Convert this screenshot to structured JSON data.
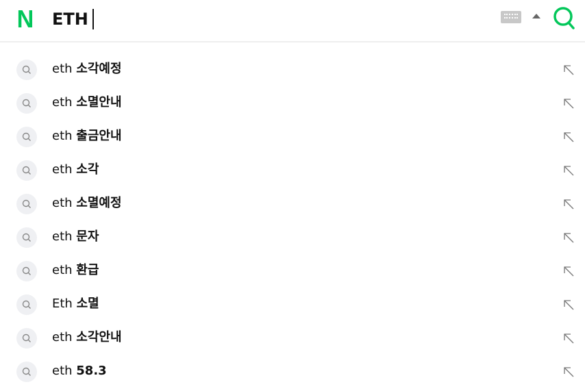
{
  "header": {
    "logo": "N",
    "query": "ETH",
    "brand_color": "#03c75a"
  },
  "suggestions": [
    {
      "prefix": "eth",
      "suffix": "소각예정"
    },
    {
      "prefix": "eth",
      "suffix": "소멸안내"
    },
    {
      "prefix": "eth",
      "suffix": "출금안내"
    },
    {
      "prefix": "eth",
      "suffix": "소각"
    },
    {
      "prefix": "eth",
      "suffix": "소멸예정"
    },
    {
      "prefix": "eth",
      "suffix": "문자"
    },
    {
      "prefix": "eth",
      "suffix": "환급"
    },
    {
      "prefix": "Eth",
      "suffix": "소멸"
    },
    {
      "prefix": "eth",
      "suffix": "소각안내"
    },
    {
      "prefix": "eth",
      "suffix": "58.3"
    }
  ]
}
